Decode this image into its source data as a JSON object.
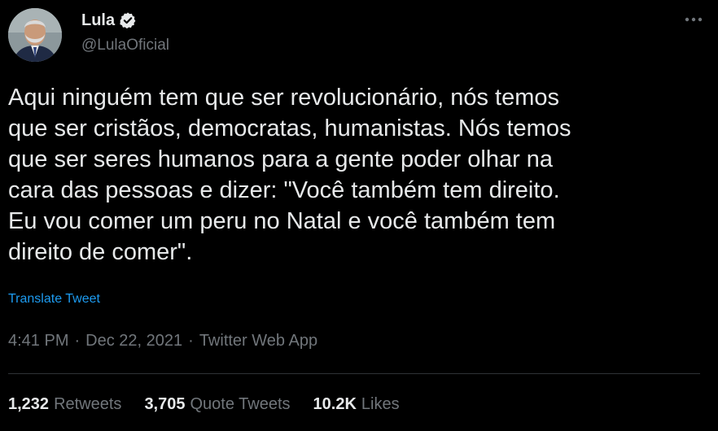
{
  "author": {
    "name": "Lula",
    "handle": "@LulaOficial",
    "verified": true,
    "avatar_icon": "avatar-photo"
  },
  "menu": {
    "icon": "more-horizontal-icon"
  },
  "tweet": {
    "text": "Aqui ninguém tem que ser revolucionário, nós temos\nque ser cristãos, democratas, humanistas. Nós temos\nque ser seres humanos para a gente poder olhar na\ncara das pessoas e dizer: \"Você também tem direito.\nEu vou comer um peru no Natal e você também tem\ndireito de comer\".",
    "translate_label": "Translate Tweet",
    "time": "4:41 PM",
    "date": "Dec 22, 2021",
    "source": "Twitter Web App",
    "separator": "·"
  },
  "stats": {
    "retweets": {
      "count": "1,232",
      "label": "Retweets"
    },
    "quote_tweets": {
      "count": "3,705",
      "label": "Quote Tweets"
    },
    "likes": {
      "count": "10.2K",
      "label": "Likes"
    }
  },
  "colors": {
    "background": "#000000",
    "text": "#e7e9ea",
    "secondary": "#71767b",
    "accent": "#1d9bf0",
    "divider": "#2f3336"
  }
}
